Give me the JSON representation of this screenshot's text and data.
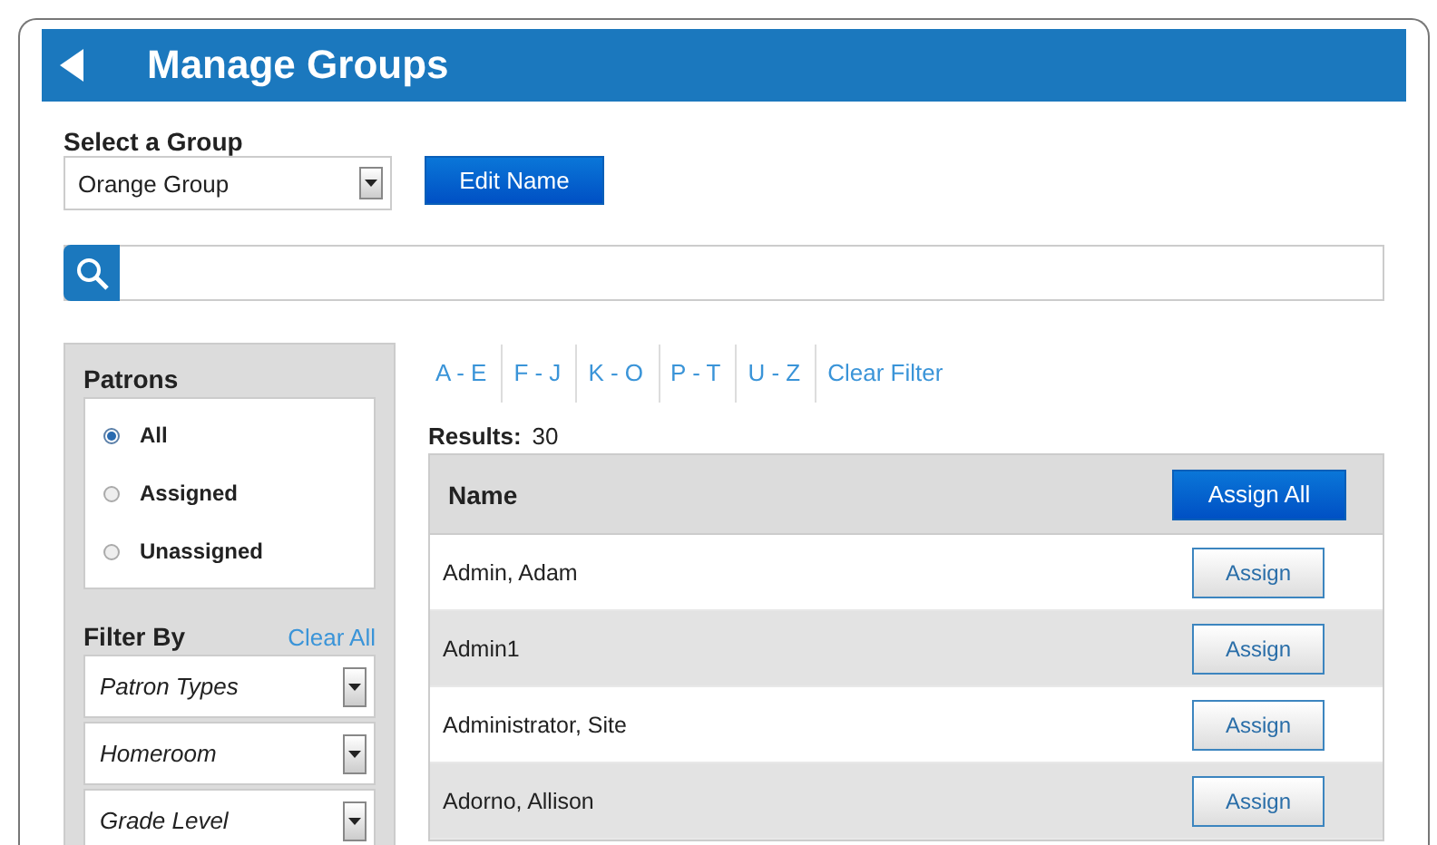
{
  "header": {
    "title": "Manage Groups"
  },
  "group_select": {
    "label": "Select a Group",
    "value": "Orange Group"
  },
  "edit_button": "Edit Name",
  "patrons": {
    "title": "Patrons",
    "options": [
      {
        "label": "All",
        "selected": true
      },
      {
        "label": "Assigned",
        "selected": false
      },
      {
        "label": "Unassigned",
        "selected": false
      }
    ]
  },
  "filter_by": {
    "title": "Filter By",
    "clear": "Clear All",
    "filters": [
      "Patron Types",
      "Homeroom",
      "Grade Level"
    ]
  },
  "letter_filters": [
    "A - E",
    "F - J",
    "K - O",
    "P - T",
    "U - Z",
    "Clear Filter"
  ],
  "results": {
    "label": "Results:",
    "count": "30"
  },
  "table": {
    "column": "Name",
    "assign_all": "Assign All",
    "rows": [
      {
        "name": "Admin, Adam",
        "action": "Assign"
      },
      {
        "name": "Admin1",
        "action": "Assign"
      },
      {
        "name": "Administrator, Site",
        "action": "Assign"
      },
      {
        "name": "Adorno, Allison",
        "action": "Assign"
      }
    ]
  }
}
